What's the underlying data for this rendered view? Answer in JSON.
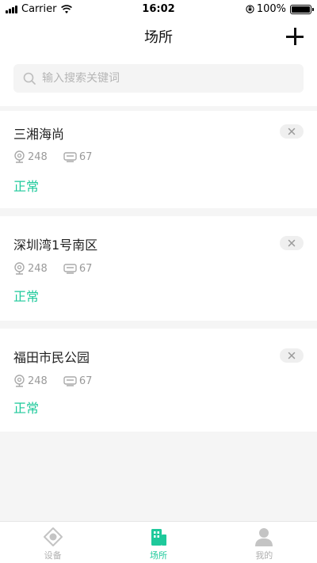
{
  "status_bar": {
    "carrier": "Carrier",
    "time": "16:02",
    "battery": "100%"
  },
  "nav": {
    "title": "场所"
  },
  "search": {
    "placeholder": "输入搜索关键词"
  },
  "places": [
    {
      "name": "三湘海尚",
      "cameras": "248",
      "devices": "67",
      "status": "正常"
    },
    {
      "name": "深圳湾1号南区",
      "cameras": "248",
      "devices": "67",
      "status": "正常"
    },
    {
      "name": "福田市民公园",
      "cameras": "248",
      "devices": "67",
      "status": "正常"
    }
  ],
  "tabs": [
    {
      "label": "设备",
      "icon": "device-icon"
    },
    {
      "label": "场所",
      "icon": "building-icon",
      "active": true
    },
    {
      "label": "我的",
      "icon": "user-icon"
    }
  ],
  "colors": {
    "accent": "#1ec99b",
    "muted": "#9a9a9a",
    "background": "#f5f5f5"
  }
}
